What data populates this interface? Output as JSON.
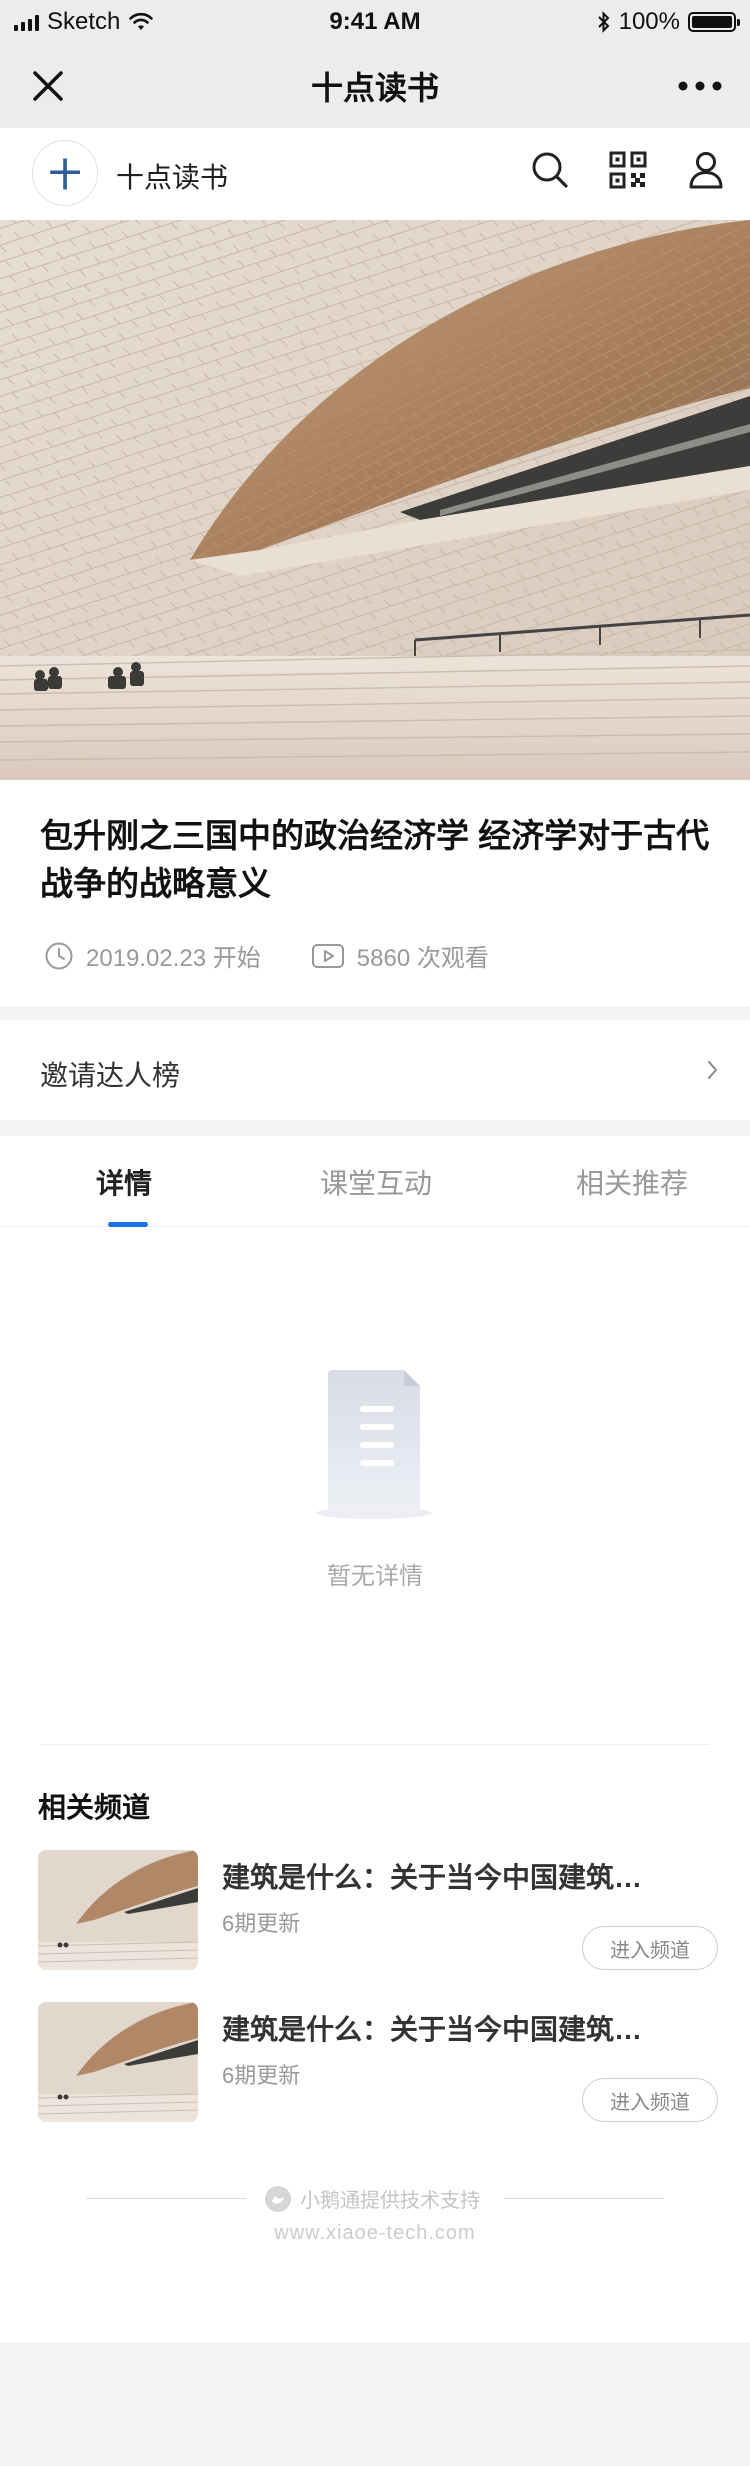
{
  "status_bar": {
    "carrier": "Sketch",
    "time": "9:41 AM",
    "battery": "100%"
  },
  "nav": {
    "title": "十点读书"
  },
  "shop": {
    "logo_text": "十",
    "name": "十点读书"
  },
  "course": {
    "title": "包升刚之三国中的政治经济学 经济学对于古代战争的战略意义",
    "start_date": "2019.02.23 开始",
    "views": "5860 次观看"
  },
  "invite": {
    "label": "邀请达人榜"
  },
  "tabs": [
    {
      "label": "详情",
      "active": true
    },
    {
      "label": "课堂互动",
      "active": false
    },
    {
      "label": "相关推荐",
      "active": false
    }
  ],
  "detail": {
    "empty_text": "暂无详情"
  },
  "related": {
    "title": "相关频道",
    "channels": [
      {
        "title": "建筑是什么：关于当今中国建筑…",
        "updates": "6期更新",
        "button": "进入频道"
      },
      {
        "title": "建筑是什么：关于当今中国建筑…",
        "updates": "6期更新",
        "button": "进入频道"
      }
    ]
  },
  "footer": {
    "brand": "小鹅通提供技术支持",
    "url": "www.xiaoe-tech.com"
  },
  "colors": {
    "accent": "#1a73e8",
    "page_bg": "#f4f5f7",
    "nav_bg": "#ececec"
  }
}
